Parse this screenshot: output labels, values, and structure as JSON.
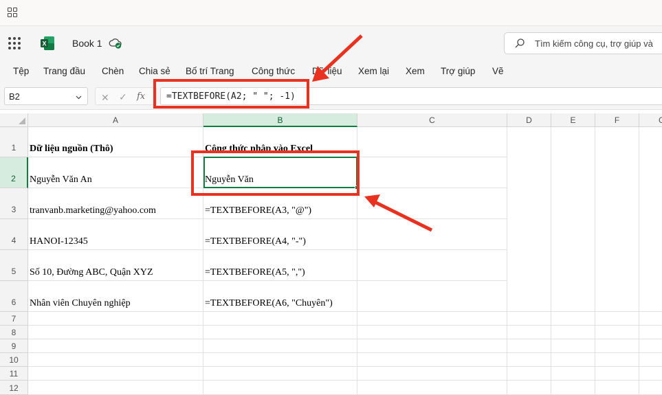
{
  "app": {
    "book_title": "Book 1",
    "search_placeholder": "Tìm kiếm công cụ, trợ giúp và"
  },
  "menu": [
    "Tệp",
    "Trang đầu",
    "Chèn",
    "Chia sẻ",
    "Bố trí Trang",
    "Công thức",
    "Dữ liệu",
    "Xem lại",
    "Xem",
    "Trợ giúp",
    "Vẽ"
  ],
  "formula_bar": {
    "name_box": "B2",
    "fx_label": "fx",
    "formula": "=TEXTBEFORE(A2; \" \"; -1)"
  },
  "columns": [
    "A",
    "B",
    "C",
    "D",
    "E",
    "F",
    "G"
  ],
  "rows": [
    "1",
    "2",
    "3",
    "4",
    "5",
    "6",
    "7",
    "8",
    "9",
    "10",
    "11",
    "12"
  ],
  "cells": {
    "A1": "Dữ liệu nguồn (Thô)",
    "B1": "Công thức nhập vào Excel",
    "A2": "Nguyễn Văn An",
    "B2": "Nguyễn Văn",
    "A3": "tranvanb.marketing@yahoo.com",
    "B3": "=TEXTBEFORE(A3, \"@\")",
    "A4": "HANOI-12345",
    "B4": "=TEXTBEFORE(A4, \"-\")",
    "A5": "Số 10, Đường ABC, Quận XYZ",
    "B5": "=TEXTBEFORE(A5, \",\")",
    "A6": "Nhân viên Chuyên nghiệp",
    "B6": "=TEXTBEFORE(A6, \"Chuyên\")"
  },
  "colors": {
    "excel_green": "#107c41",
    "annotation_red": "#e8321f"
  },
  "selected_cell": "B2"
}
